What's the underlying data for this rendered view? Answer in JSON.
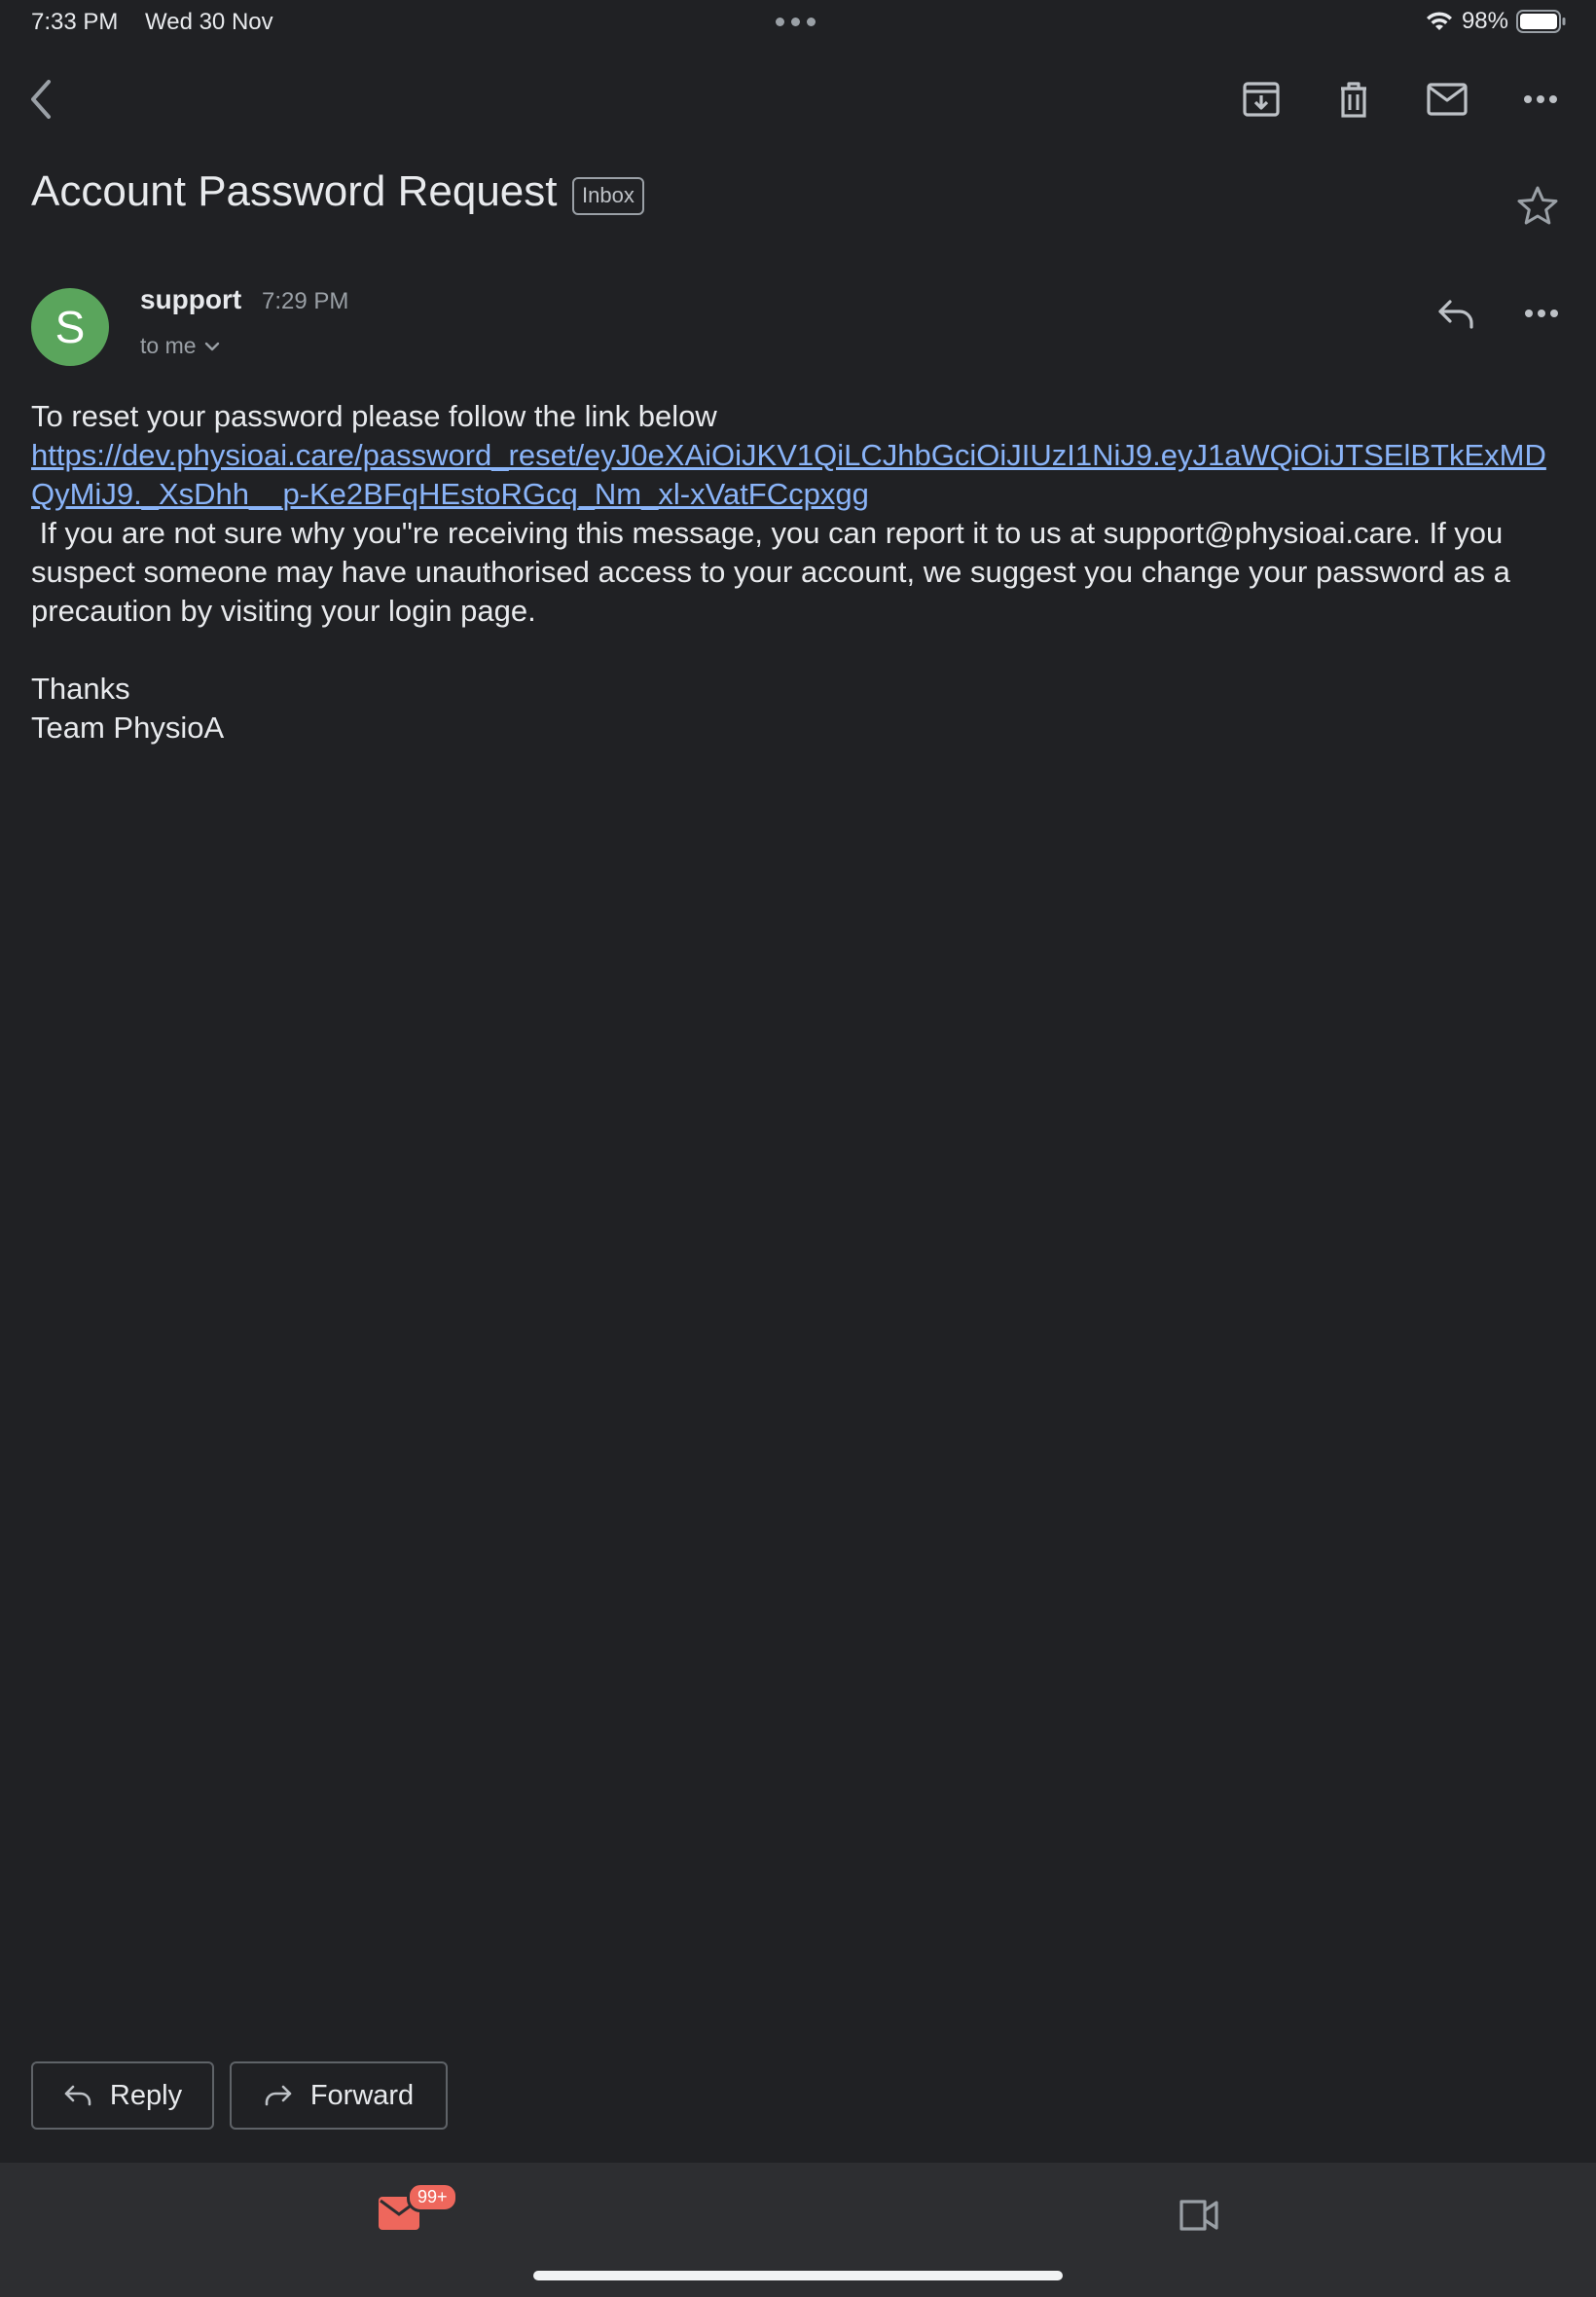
{
  "status_bar": {
    "time": "7:33 PM",
    "date": "Wed 30 Nov",
    "battery": "98%",
    "icons": [
      "multitask-dots-icon",
      "wifi-icon",
      "battery-icon"
    ]
  },
  "toolbar": {
    "icons": [
      "back-icon",
      "archive-icon",
      "delete-icon",
      "mark-unread-icon",
      "more-icon"
    ]
  },
  "email": {
    "subject": "Account Password Request",
    "label": "Inbox",
    "sender": {
      "initial": "S",
      "name": "support",
      "time": "7:29 PM",
      "recipient": "to me",
      "avatar_color": "#5aa55c"
    },
    "body": {
      "line1": "To reset your password please follow the link below",
      "link": "https://dev.physioai.care/password_reset/eyJ0eXAiOiJKV1QiLCJhbGciOiJIUzI1NiJ9.eyJ1aWQiOiJTSElBTkExMDQyMiJ9._XsDhh__p-Ke2BFqHEstoRGcq_Nm_xl-xVatFCcpxgg",
      "paragraph": " If you are not sure why you\"re receiving this message, you can report it to us at support@physioai.care. If you suspect someone may have unauthorised access to your account, we suggest you change your password as a precaution by visiting your login page.",
      "sign_off": "Thanks",
      "signature": "Team PhysioA"
    }
  },
  "actions": {
    "reply_label": "Reply",
    "forward_label": "Forward"
  },
  "bottom_nav": {
    "mail_badge": "99+",
    "mail_color": "#ee675c"
  },
  "colors": {
    "background": "#202124",
    "link": "#8ab4f8",
    "muted_text": "#9aa0a6"
  }
}
